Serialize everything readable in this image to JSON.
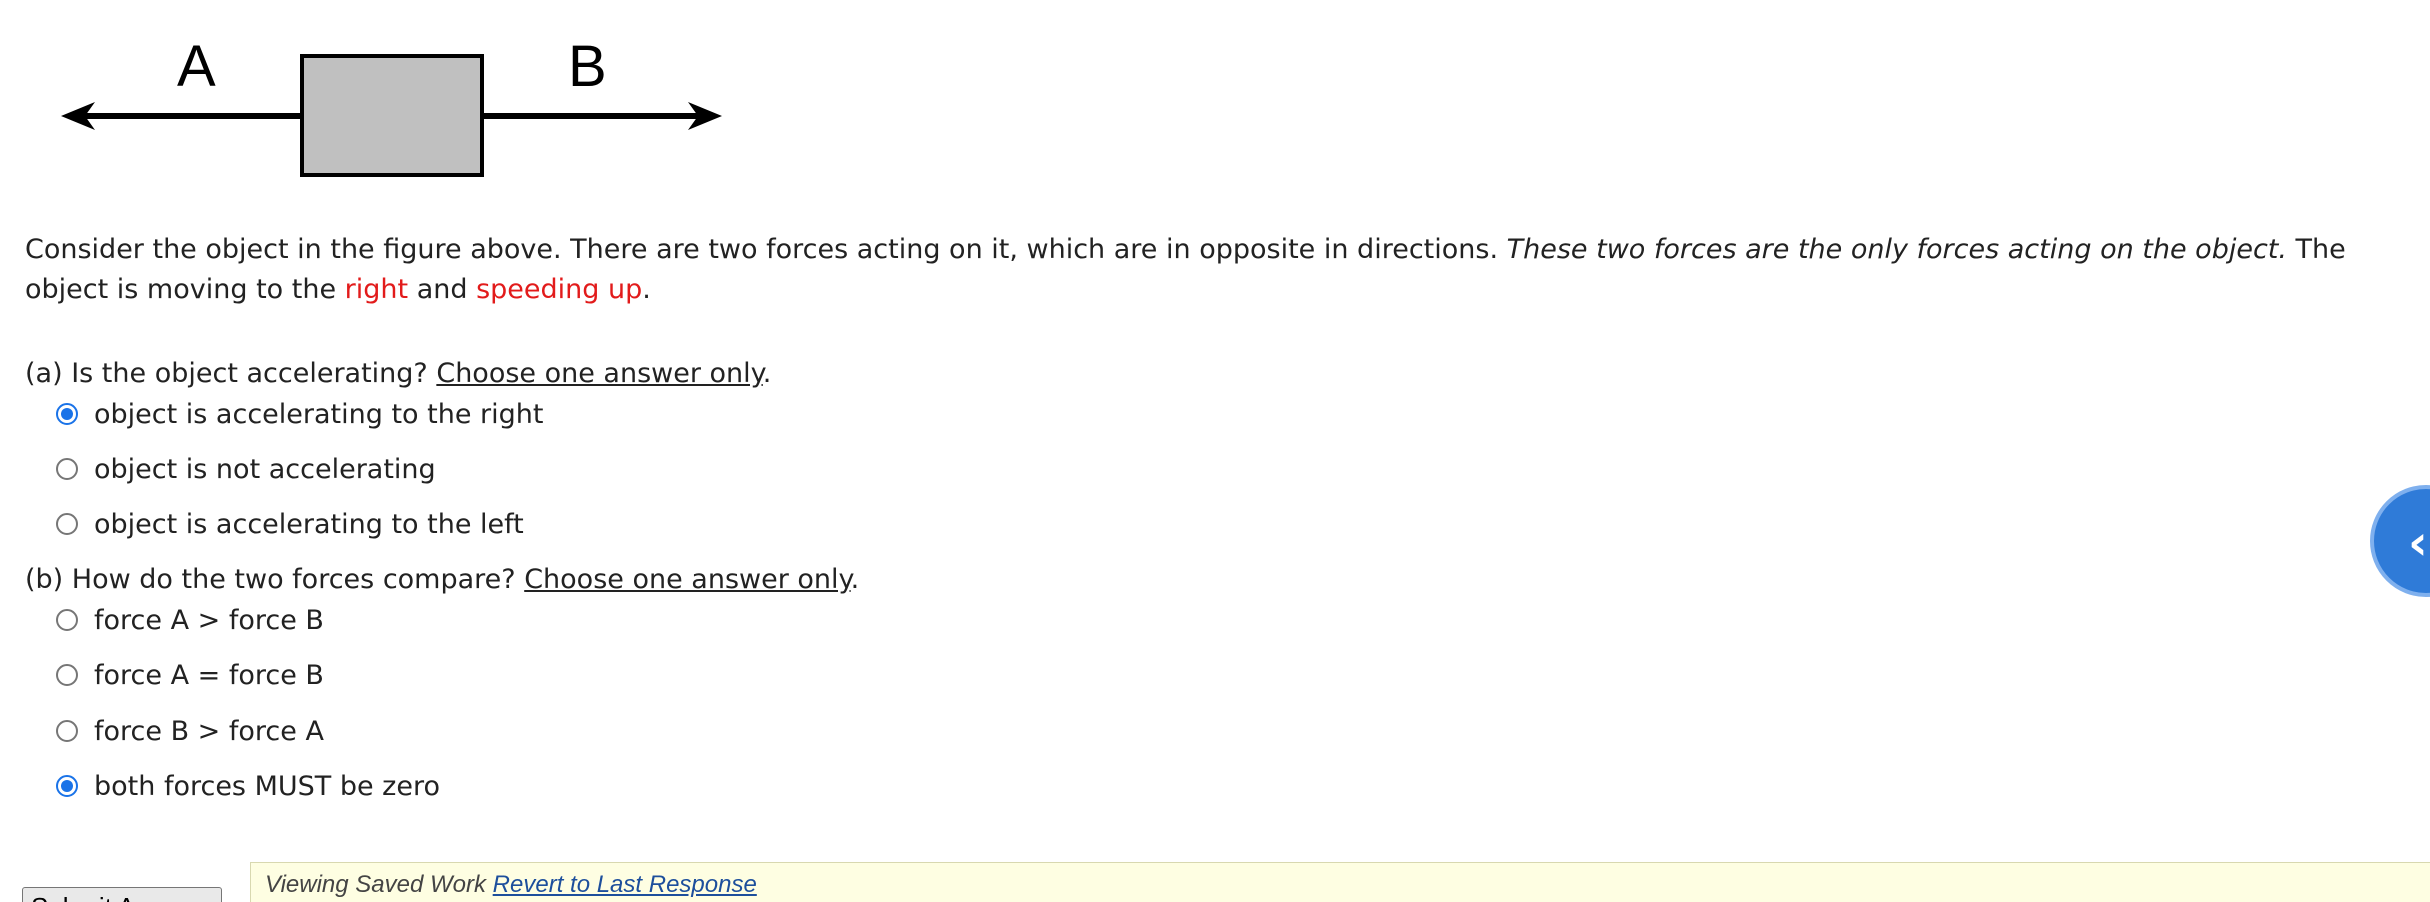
{
  "figure": {
    "label_a": "A",
    "label_b": "B",
    "box_fill": "#c0c0c0"
  },
  "paragraph": {
    "part1": "Consider the object in the figure above. There are two forces acting on it, which are in opposite in directions. ",
    "italic": "These two forces are the only forces acting on the object.",
    "part2": " The object is moving to the ",
    "red1": "right",
    "part3": " and ",
    "red2": "speeding up",
    "part4": "."
  },
  "question_a": {
    "prefix": "(a) Is the object accelerating? ",
    "instruction": "Choose one answer only",
    "suffix": ".",
    "options": [
      {
        "label": "object is accelerating to the right",
        "checked": true
      },
      {
        "label": "object is not accelerating",
        "checked": false
      },
      {
        "label": "object is accelerating to the left",
        "checked": false
      }
    ]
  },
  "question_b": {
    "prefix": "(b) How do the two forces compare? ",
    "instruction": "Choose one answer only",
    "suffix": ".",
    "options": [
      {
        "label": "force A > force B",
        "checked": false
      },
      {
        "label": "force A = force B",
        "checked": false
      },
      {
        "label": "force B > force A",
        "checked": false
      },
      {
        "label": "both forces MUST be zero",
        "checked": true
      }
    ]
  },
  "submit": {
    "label": "Submit Answer"
  },
  "saved_bar": {
    "text": "Viewing Saved Work ",
    "link": "Revert to Last Response"
  },
  "accent_color": "#1a73e8",
  "highlight_color": "#e21b1b",
  "help_icon": "chevron-icon"
}
